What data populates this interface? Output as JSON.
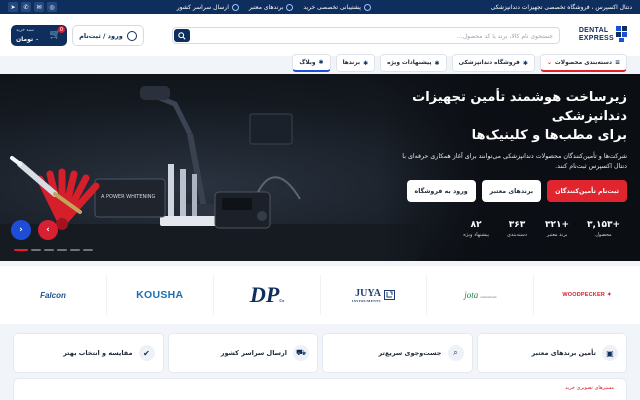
{
  "topbar": {
    "tagline": "دنتال اکسپرس ، فروشگاه تخصصی تجهیزات دندانپزشکی",
    "perks": [
      "پشتیبانی تخصصی خرید",
      "برندهای معتبر",
      "ارسال سراسر کشور"
    ],
    "socials": [
      "telegram-icon",
      "whatsapp-icon",
      "email-icon",
      "instagram-icon"
    ]
  },
  "header": {
    "logo_line1": "DENTAL",
    "logo_line2": "EXPRESS",
    "search_placeholder": "جستجوی نام کالا، برند یا کد محصول...",
    "login_label": "ورود / ثبت‌نام",
    "cart_badge": "0",
    "cart_label": "سبد خرید",
    "cart_value": "۰ تومان"
  },
  "nav": {
    "items": [
      {
        "label": "دسته‌بندی محصولات",
        "icon": "chevron-down-icon"
      },
      {
        "label": "فروشگاه دندانپزشکی",
        "icon": "star-icon"
      },
      {
        "label": "پیشنهادات ویژه",
        "icon": "star-icon"
      },
      {
        "label": "برندها",
        "icon": "star-icon"
      },
      {
        "label": "وبلاگ",
        "icon": "star-icon"
      }
    ]
  },
  "hero": {
    "title_line1": "زیرساخت هوشمند تأمین تجهیزات",
    "title_line2": "دندانپزشکی",
    "title_line3": "برای مطب‌ها و کلینیک‌ها",
    "description": "شرکت‌ها و تأمین‌کنندگان محصولات دندانپزشکی می‌توانند برای آغاز همکاری حرفه‌ای با دنتال اکسپرس ثبت‌نام کنند.",
    "cta_primary": "ثبت‌نام تأمین‌کنندگان",
    "cta_secondary": "برندهای معتبر",
    "cta_tertiary": "ورود به فروشگاه",
    "image_text": "A POWER WHITENING",
    "stats": [
      {
        "value": "+۳,۱۵۳",
        "label": "محصول"
      },
      {
        "value": "+۳۲۱",
        "label": "برند معتبر"
      },
      {
        "value": "۳۶۳",
        "label": "دسته‌بندی"
      },
      {
        "value": "۸۲",
        "label": "پیشنهاد ویژه"
      }
    ],
    "slide_count": 6,
    "active_slide": 0
  },
  "brands": [
    {
      "name": "WOODPECKER",
      "color": "#d61f2b"
    },
    {
      "name": "jota",
      "sub": "switzerland",
      "color": "#27804a"
    },
    {
      "name": "JUYA",
      "sub": "INSTRUMENTS",
      "color": "#1a3b73"
    },
    {
      "name": "DP",
      "sub": "Co.",
      "color": "#0e2f5e"
    },
    {
      "name": "KOUSHA",
      "color": "#1b6fb5"
    },
    {
      "name": "Falcon",
      "color": "#1d4f91"
    }
  ],
  "features": [
    {
      "label": "تأمین برندهای معتبر",
      "icon": "box-icon"
    },
    {
      "label": "جست‌وجوی سریع‌تر",
      "icon": "search-icon"
    },
    {
      "label": "ارسال سراسر کشور",
      "icon": "truck-icon"
    },
    {
      "label": "مقایسه و انتخاب بهتر",
      "icon": "check-icon"
    }
  ],
  "bottom": {
    "kicker": "مسیرهای تصویری خرید"
  },
  "colors": {
    "navy": "#0e2f5e",
    "accent_red": "#e0252f",
    "accent_blue": "#1d4ed8"
  }
}
